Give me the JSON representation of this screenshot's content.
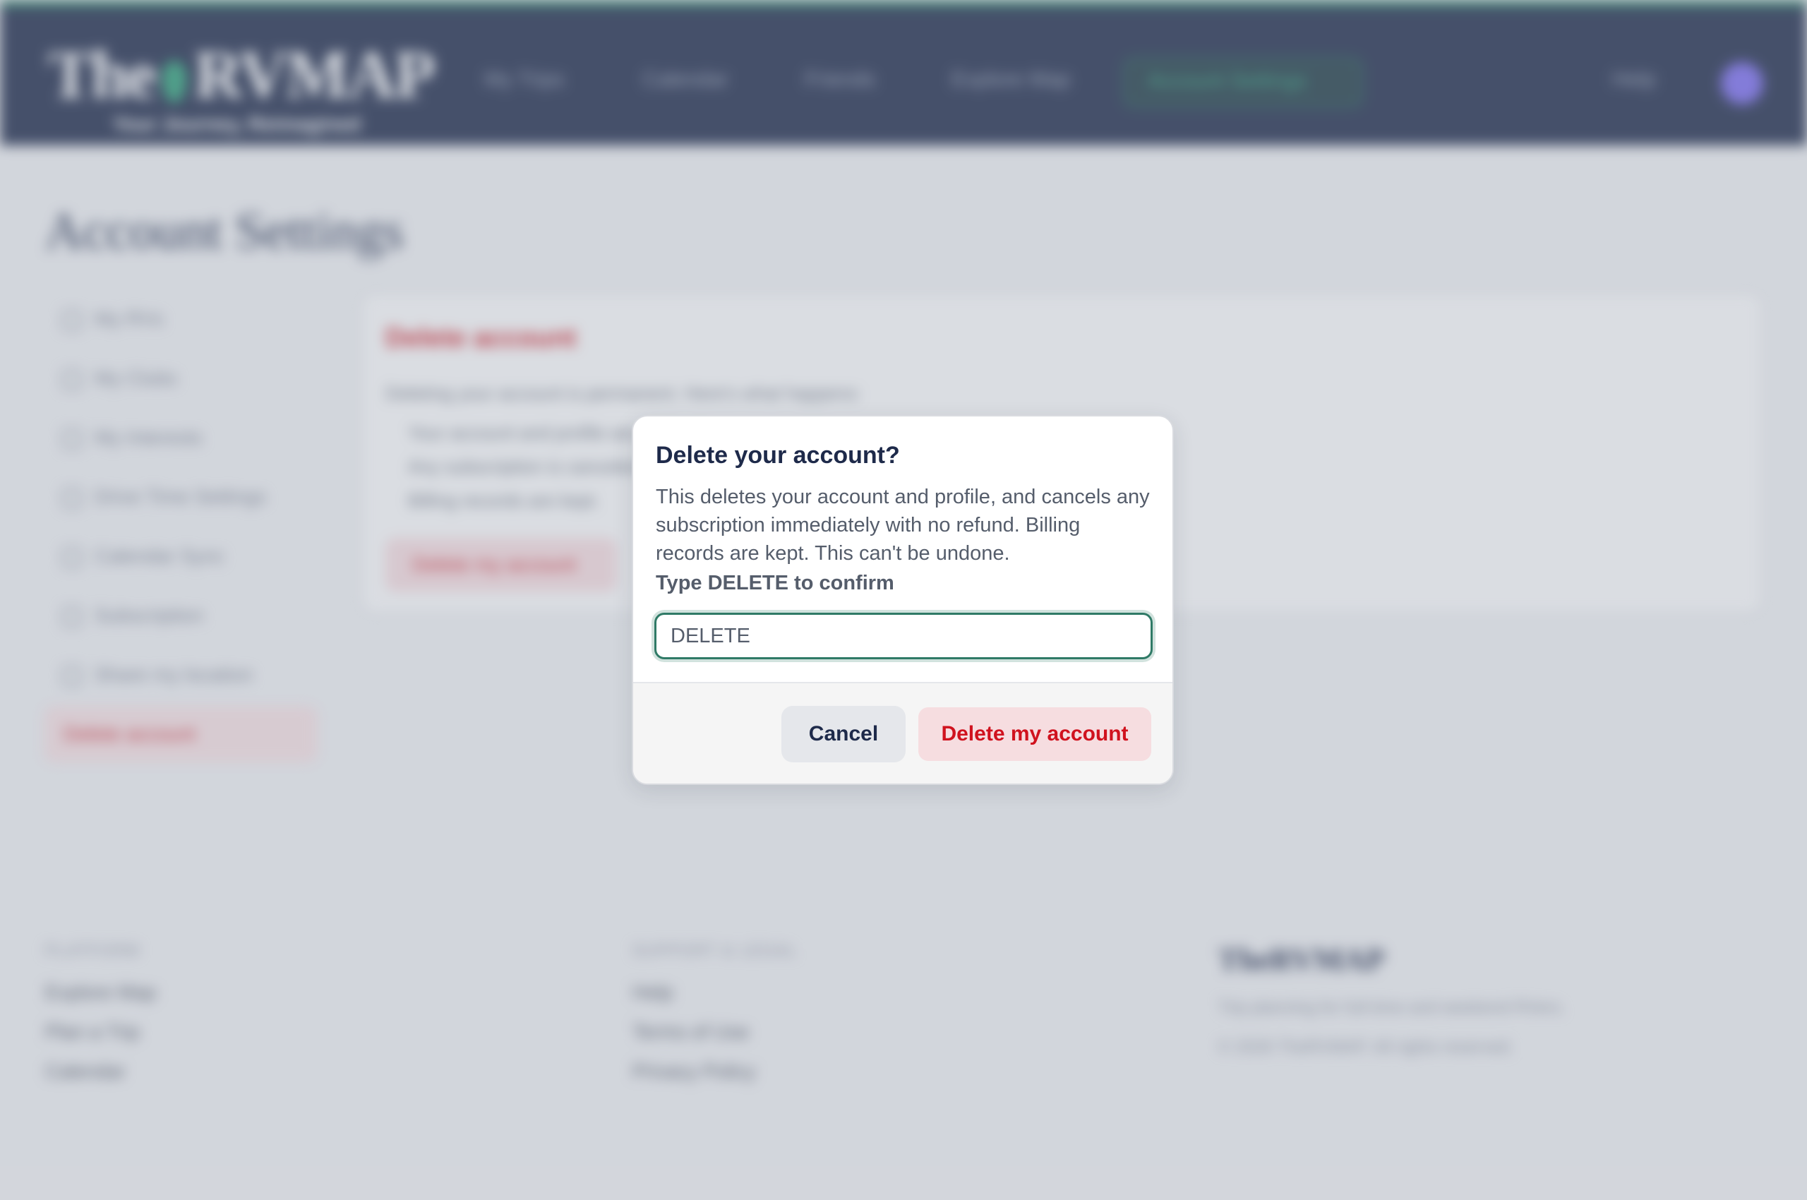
{
  "header": {
    "logo_left": "The",
    "logo_right": "RVMAP",
    "tagline": "Your Journey, Reimagined",
    "nav": [
      "My Trips",
      "Calendar",
      "Friends",
      "Explore Map"
    ],
    "nav_active": "Account Settings",
    "help": "Help"
  },
  "page": {
    "title": "Account Settings"
  },
  "sidebar": {
    "items": [
      {
        "label": "My RVs",
        "icon": "rv-icon"
      },
      {
        "label": "My Clubs",
        "icon": "clubs-icon"
      },
      {
        "label": "My Interests",
        "icon": "heart-icon"
      },
      {
        "label": "Drive Time Settings",
        "icon": "clock-icon"
      },
      {
        "label": "Calendar Sync",
        "icon": "calendar-icon"
      },
      {
        "label": "Subscription",
        "icon": "card-icon"
      },
      {
        "label": "Share my location",
        "icon": "location-icon"
      }
    ],
    "active": {
      "label": "Delete account",
      "icon": "trash-icon"
    }
  },
  "panel": {
    "title": "Delete account",
    "intro": "Deleting your account is permanent. Here's what happens:",
    "bullets": [
      "Your account and profile are deleted.",
      "Any subscription is canceled immediately — there's no refund for time already paid for.",
      "Billing records are kept."
    ],
    "button": "Delete my account"
  },
  "footer": {
    "platform_heading": "PLATFORM",
    "platform_links": [
      "Explore Map",
      "Plan a Trip",
      "Calendar"
    ],
    "support_heading": "SUPPORT & LEGAL",
    "support_links": [
      "Help",
      "Terms of Use",
      "Privacy Policy"
    ],
    "logo": "TheRVMAP",
    "blurb": "Trip planning for full-time and weekend RVers.",
    "copyright": "© 2026 TheRVMAP. All rights reserved."
  },
  "modal": {
    "title": "Delete your account?",
    "description": "This deletes your account and profile, and cancels any subscription immediately with no refund. Billing records are kept. This can't be undone.",
    "confirm_label": "Type DELETE to confirm",
    "confirm_value": "DELETE",
    "cancel_label": "Cancel",
    "delete_label": "Delete my account"
  },
  "colors": {
    "header_bg": "#1e2a4a",
    "accent_green": "#2f7a66",
    "danger_red": "#d0121e",
    "danger_bg": "#f6dde0"
  }
}
